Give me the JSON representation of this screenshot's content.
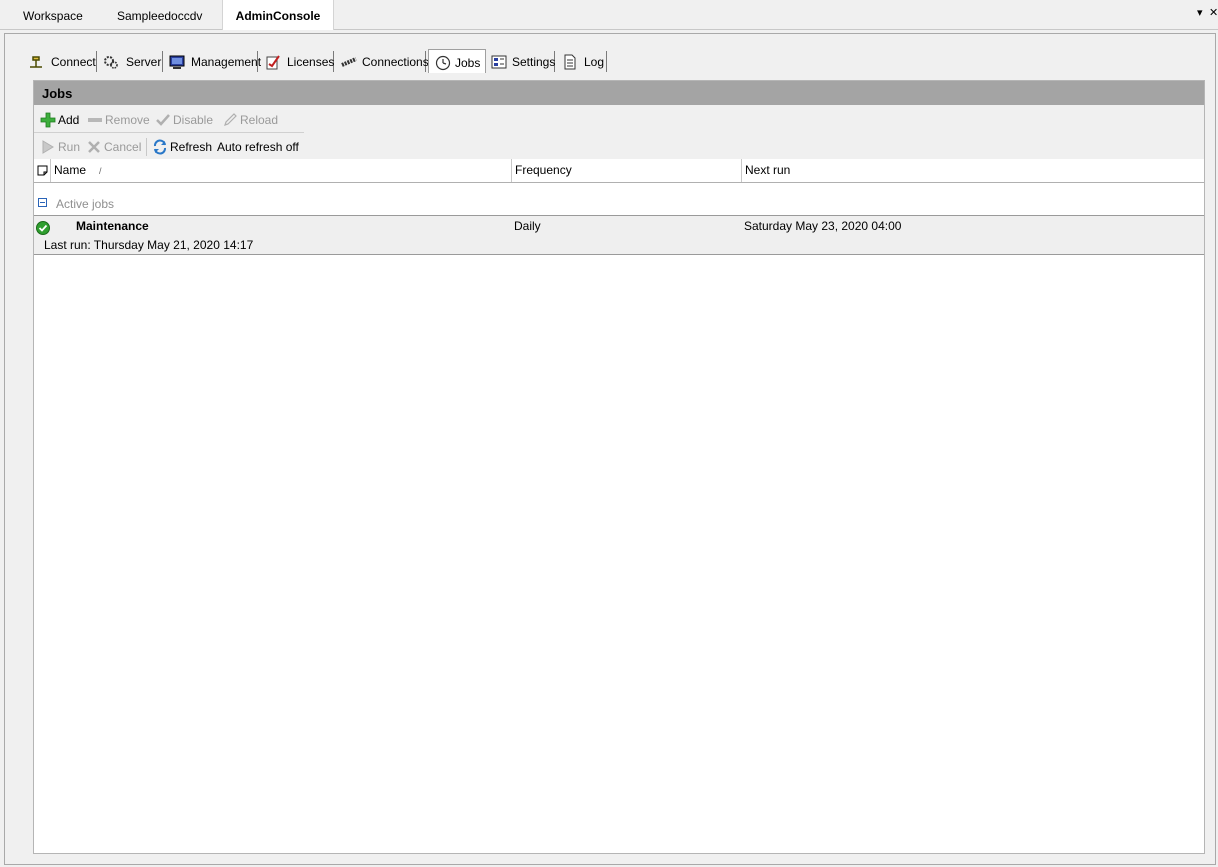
{
  "doc_tabs": [
    {
      "label": "Workspace"
    },
    {
      "label": "Sampleedoccdv"
    },
    {
      "label": "AdminConsole"
    }
  ],
  "strip_controls": {
    "dropdown": "▾",
    "close": "✕"
  },
  "property_tabs": [
    {
      "label": "Connect",
      "icon": "plug-icon"
    },
    {
      "label": "Server",
      "icon": "gears-icon"
    },
    {
      "label": "Management",
      "icon": "monitor-icon"
    },
    {
      "label": "Licenses",
      "icon": "license-icon"
    },
    {
      "label": "Connections",
      "icon": "connections-icon"
    },
    {
      "label": "Jobs",
      "icon": "clock-icon"
    },
    {
      "label": "Settings",
      "icon": "settings-icon"
    },
    {
      "label": "Log",
      "icon": "document-icon"
    }
  ],
  "panel": {
    "title": "Jobs"
  },
  "toolbar": {
    "add": "Add",
    "remove": "Remove",
    "disable": "Disable",
    "reload": "Reload",
    "run": "Run",
    "cancel": "Cancel",
    "refresh": "Refresh",
    "auto_refresh": "Auto refresh off"
  },
  "grid": {
    "columns": {
      "name": "Name",
      "sort_glyph": "/",
      "frequency": "Frequency",
      "next_run": "Next run"
    },
    "group": {
      "label": "Active jobs"
    },
    "rows": [
      {
        "name": "Maintenance",
        "frequency": "Daily",
        "next_run": "Saturday May 23, 2020 04:00",
        "last_run": "Last run: Thursday May 21, 2020 14:17",
        "status": "success"
      }
    ]
  },
  "colors": {
    "title_bar": "#a4a4a4",
    "status_ok": "#2e9e2e",
    "accent_blue": "#2a64b8"
  }
}
